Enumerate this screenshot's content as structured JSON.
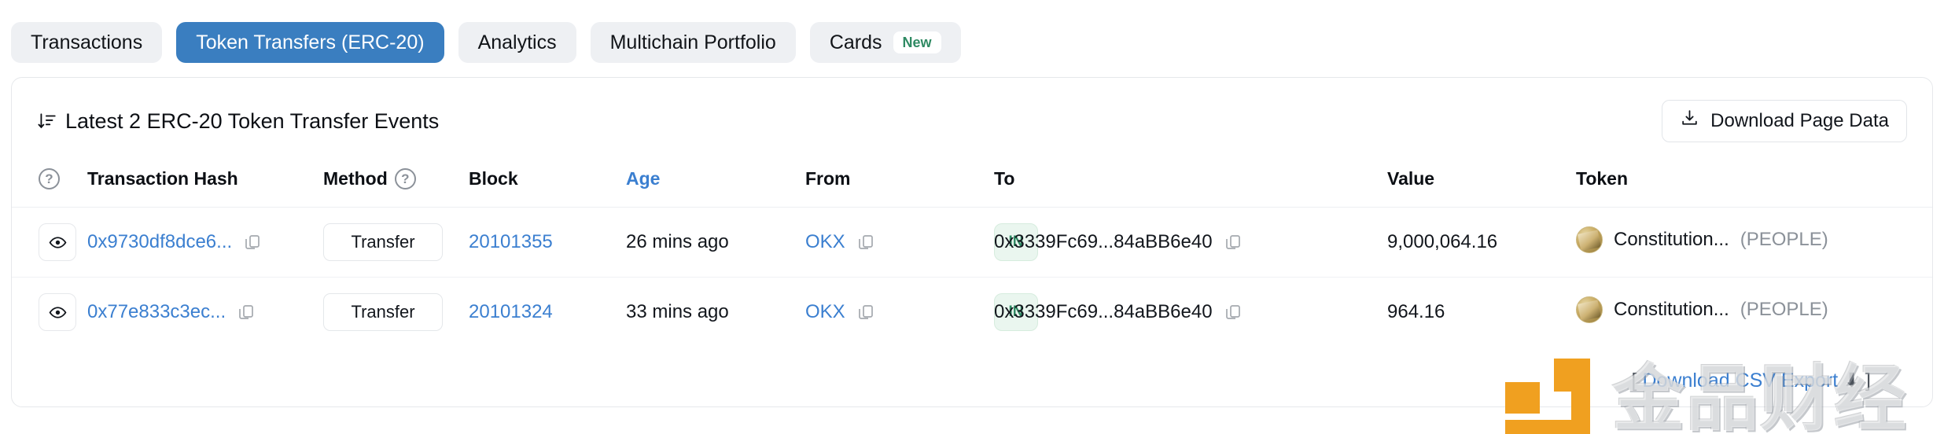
{
  "tabs": [
    {
      "label": "Transactions",
      "active": false
    },
    {
      "label": "Token Transfers (ERC-20)",
      "active": true
    },
    {
      "label": "Analytics",
      "active": false
    },
    {
      "label": "Multichain Portfolio",
      "active": false
    },
    {
      "label": "Cards",
      "active": false,
      "badge": "New"
    }
  ],
  "panel": {
    "title": "Latest 2 ERC-20 Token Transfer Events",
    "download_button": "Download Page Data"
  },
  "table": {
    "headers": {
      "info": "?",
      "txn_hash": "Transaction Hash",
      "method": "Method",
      "method_info": "?",
      "block": "Block",
      "age": "Age",
      "from": "From",
      "to": "To",
      "value": "Value",
      "token": "Token"
    },
    "rows": [
      {
        "txn_hash": "0x9730df8dce6...",
        "method": "Transfer",
        "block": "20101355",
        "age": "26 mins ago",
        "from": "OKX",
        "direction": "IN",
        "to": "0x3339Fc69...84aBB6e40",
        "value": "9,000,064.16",
        "token_name": "Constitution...",
        "token_symbol": "(PEOPLE)"
      },
      {
        "txn_hash": "0x77e833c3ec...",
        "method": "Transfer",
        "block": "20101324",
        "age": "33 mins ago",
        "from": "OKX",
        "direction": "IN",
        "to": "0x3339Fc69...84aBB6e40",
        "value": "964.16",
        "token_name": "Constitution...",
        "token_symbol": "(PEOPLE)"
      }
    ]
  },
  "footer": {
    "prefix": "[ ",
    "link": "Download CSV Export",
    "suffix": " ]"
  },
  "watermark": {
    "text": "金品财经"
  },
  "colors": {
    "accent": "#3b7fd0",
    "tab_active_bg": "#3a7ec0",
    "badge_green": "#2f8a63",
    "in_badge_bg": "#eaf6ef"
  }
}
